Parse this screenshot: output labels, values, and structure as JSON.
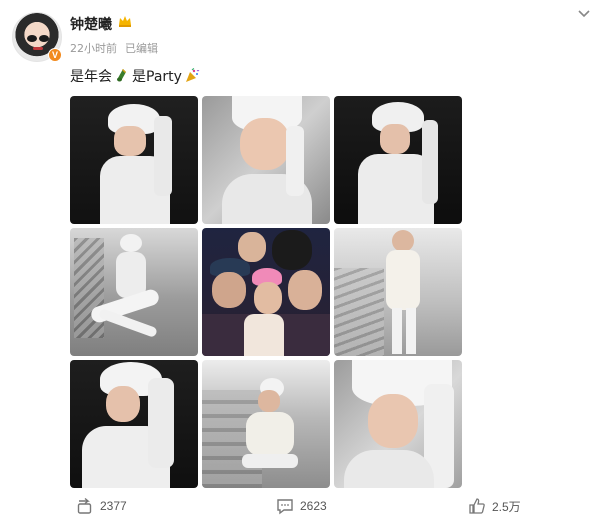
{
  "post": {
    "username": "钟楚曦",
    "time": "22小时前",
    "edited": "已编辑",
    "text_part1": "是年会",
    "text_part2": "是Party"
  },
  "icons": {
    "verified": "V",
    "crown": "crown-icon",
    "champagne": "champagne-icon",
    "party": "party-popper-icon",
    "chevron": "chevron-down-icon",
    "repost": "repost-icon",
    "comment": "comment-icon",
    "like": "like-icon"
  },
  "actions": {
    "repost_count": "2377",
    "comment_count": "2623",
    "like_count": "2.5万"
  },
  "colors": {
    "verified_orange": "#f28a1e",
    "crown_gold": "#f5b400",
    "meta_gray": "#999999"
  }
}
